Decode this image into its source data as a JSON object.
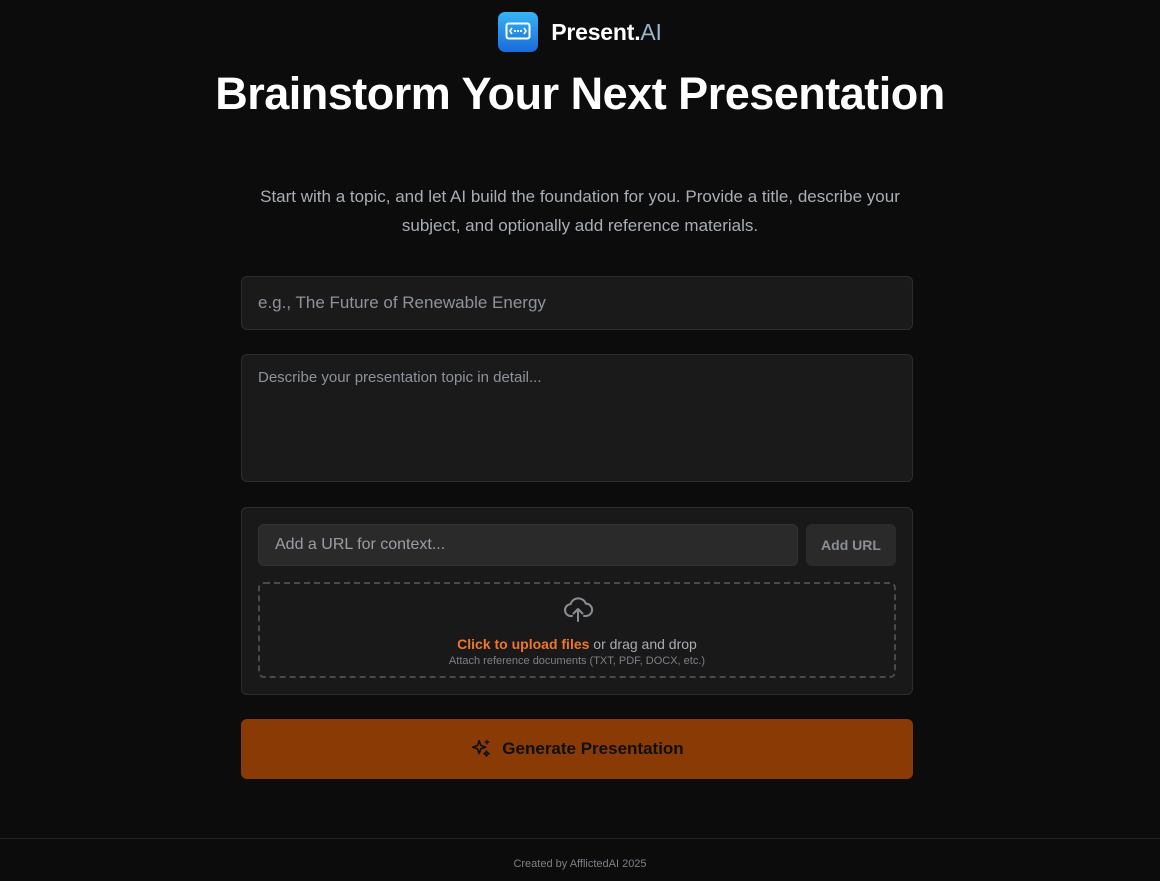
{
  "brand": {
    "name": "Present.",
    "name_accent": "AI",
    "logo_icon": "presentation-logo-icon",
    "logo_color": "#2a8ee8"
  },
  "hero": {
    "title": "Brainstorm Your Next Presentation",
    "subtitle": "Start with a topic, and let AI build the foundation for you. Provide a title, describe your subject, and optionally add reference materials."
  },
  "form": {
    "title_placeholder": "e.g., The Future of Renewable Energy",
    "description_placeholder": "Describe your presentation topic in detail...",
    "url_placeholder": "Add a URL for context...",
    "add_url_label": "Add URL",
    "upload": {
      "icon": "cloud-upload-icon",
      "link_text": "Click to upload files",
      "rest_text": " or drag and drop",
      "hint": "Attach reference documents (TXT, PDF, DOCX, etc.)"
    },
    "generate": {
      "icon": "sparkles-icon",
      "label": "Generate Presentation",
      "color": "#8a3b05"
    }
  },
  "footer": {
    "credit": "Created by AfflictedAI 2025"
  },
  "colors": {
    "background": "#0c0c0c",
    "accent_orange": "#f07628",
    "field_bg": "#1a1a1a"
  }
}
